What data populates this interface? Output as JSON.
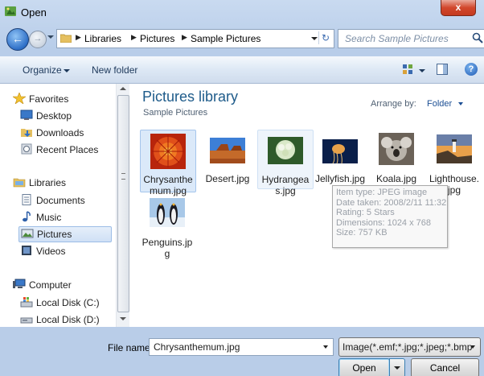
{
  "window": {
    "title": "Open",
    "close_label": "x"
  },
  "address": {
    "crumbs": [
      "Libraries",
      "Pictures",
      "Sample Pictures"
    ],
    "search_placeholder": "Search Sample Pictures"
  },
  "toolbar": {
    "organize": "Organize",
    "new_folder": "New folder"
  },
  "nav": {
    "items": [
      {
        "label": "Favorites",
        "icon": "star-icon"
      },
      {
        "label": "Desktop",
        "icon": "desktop-icon"
      },
      {
        "label": "Downloads",
        "icon": "downloads-icon"
      },
      {
        "label": "Recent Places",
        "icon": "recent-places-icon"
      },
      {
        "label": "Libraries",
        "icon": "libraries-icon"
      },
      {
        "label": "Documents",
        "icon": "documents-icon"
      },
      {
        "label": "Music",
        "icon": "music-icon"
      },
      {
        "label": "Pictures",
        "icon": "pictures-icon"
      },
      {
        "label": "Videos",
        "icon": "videos-icon"
      },
      {
        "label": "Computer",
        "icon": "computer-icon"
      },
      {
        "label": "Local Disk (C:)",
        "icon": "local-disk-icon"
      },
      {
        "label": "Local Disk (D:)",
        "icon": "local-disk-icon"
      }
    ]
  },
  "content": {
    "title": "Pictures library",
    "subtitle": "Sample Pictures",
    "arrange_label": "Arrange by:",
    "arrange_value": "Folder",
    "files": [
      {
        "name": "Chrysanthemum.jpg",
        "display": "Chrysanthe mum.jpg",
        "selected": true
      },
      {
        "name": "Desert.jpg",
        "display": "Desert.jpg",
        "selected": false
      },
      {
        "name": "Hydrangeas.jpg",
        "display": "Hydrangea s.jpg",
        "selected": false
      },
      {
        "name": "Jellyfish.jpg",
        "display": "Jellyfish.jpg",
        "selected": false
      },
      {
        "name": "Koala.jpg",
        "display": "Koala.jpg",
        "selected": false
      },
      {
        "name": "Lighthouse.jpg",
        "display": "Lighthouse. jpg",
        "selected": false
      },
      {
        "name": "Penguins.jpg",
        "display": "Penguins.jp g",
        "selected": false
      }
    ],
    "tooltip": [
      "Item type: JPEG image",
      "Date taken: 2008/2/11 11:32",
      "Rating: 5 Stars",
      "Dimensions: 1024 x 768",
      "Size: 757 KB"
    ]
  },
  "footer": {
    "file_name_label": "File name:",
    "file_name_value": "Chrysanthemum.jpg",
    "filter_value": "Image(*.emf;*.jpg;*.jpeg;*.bmp",
    "open_label": "Open",
    "cancel_label": "Cancel"
  }
}
